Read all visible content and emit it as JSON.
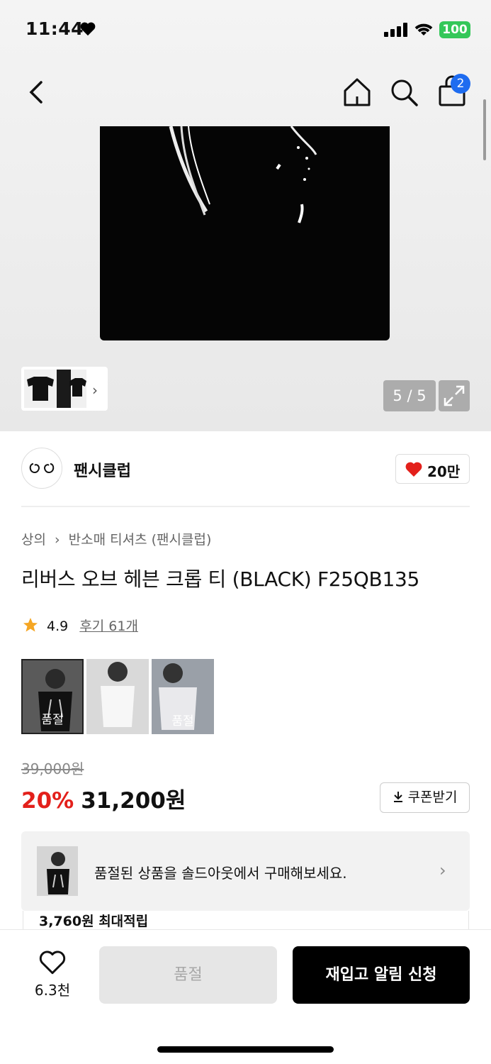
{
  "status_bar": {
    "time": "11:44",
    "battery": "100"
  },
  "header": {
    "cart_count": "2"
  },
  "gallery": {
    "counter": "5 / 5"
  },
  "brand": {
    "name": "팬시클럽",
    "likes": "20만"
  },
  "breadcrumb": {
    "category": "상의",
    "subcategory": "반소매 티셔츠 (팬시클럽)"
  },
  "product": {
    "title": "리버스 오브 헤븐 크롭 티 (BLACK) F25QB135",
    "rating": "4.9",
    "reviews": "후기 61개"
  },
  "color_options": [
    {
      "label": "품절"
    },
    {
      "label": ""
    },
    {
      "label": "품절"
    }
  ],
  "price": {
    "original": "39,000원",
    "discount": "20%",
    "final": "31,200원",
    "coupon_label": "쿠폰받기"
  },
  "banner": {
    "text": "품절된 상품을 솔드아웃에서 구매해보세요."
  },
  "points": {
    "text": "3,760원 최대적립"
  },
  "bottom": {
    "wish_count": "6.3천",
    "soldout_label": "품절",
    "restock_label": "재입고 알림 신청"
  },
  "colors": {
    "accent_red": "#e3201b",
    "badge_blue": "#1e6cf0",
    "battery_green": "#34c759"
  }
}
